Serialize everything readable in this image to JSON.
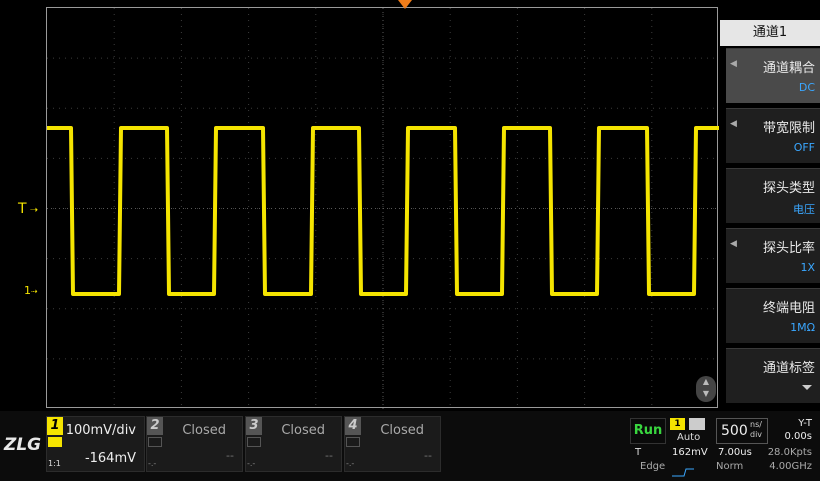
{
  "trigger_label": "T",
  "channel_marker_label": "1",
  "menu": {
    "title": "通道1",
    "items": [
      {
        "label": "通道耦合",
        "value": "DC"
      },
      {
        "label": "带宽限制",
        "value": "OFF"
      },
      {
        "label": "探头类型",
        "value": "电压"
      },
      {
        "label": "探头比率",
        "value": "1X"
      },
      {
        "label": "终端电阻",
        "value": "1MΩ"
      },
      {
        "label": "通道标签",
        "value": ""
      }
    ]
  },
  "logo": "ZLG",
  "channels": [
    {
      "num": "1",
      "line1": "100mV/div",
      "line2": "-164mV",
      "ratio": "1:1",
      "color": "#f5e400"
    },
    {
      "num": "2",
      "line1": "Closed",
      "line2": "--",
      "ratio": "-.-",
      "color": "#555555"
    },
    {
      "num": "3",
      "line1": "Closed",
      "line2": "--",
      "ratio": "-.-",
      "color": "#555555"
    },
    {
      "num": "4",
      "line1": "Closed",
      "line2": "--",
      "ratio": "-.-",
      "color": "#555555"
    }
  ],
  "status": {
    "run": "Run",
    "trigger_channel": "1",
    "trigger_mode": "Auto",
    "trigger_source_label": "T",
    "trigger_level": "162mV",
    "trigger_type": "Edge",
    "timebase_value": "500",
    "timebase_unit_top": "ns/",
    "timebase_unit_bottom": "div",
    "time_delay": "7.00us",
    "acq_mode": "Norm",
    "mode": "Y-T",
    "offset": "0.00s",
    "memory": "28.0Kpts",
    "sample_rate": "4.00GHz"
  }
}
